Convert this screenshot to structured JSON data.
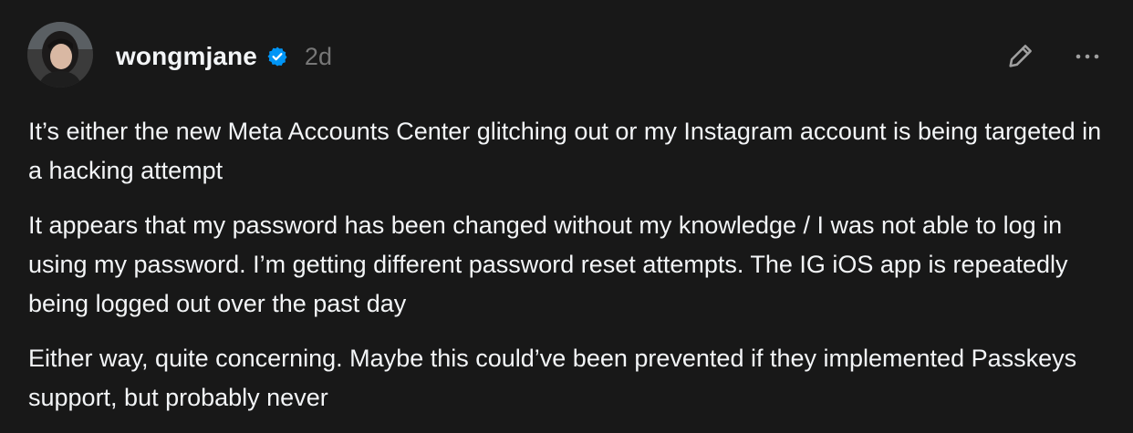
{
  "post": {
    "author": {
      "username": "wongmjane",
      "verified": true,
      "avatar_icon": "profile-photo"
    },
    "timestamp": "2d",
    "actions": {
      "edit_icon": "pencil-icon",
      "more_icon": "more-horizontal-icon"
    },
    "paragraphs": [
      "It’s either the new Meta Accounts Center glitching out or my Instagram account is being targeted in a hacking attempt",
      "It appears that my password has been changed without my knowledge / I was not able to log in using my password. I’m getting different password reset attempts. The IG iOS app is repeatedly being logged out over the past day",
      "Either way, quite concerning. Maybe this could’ve been prevented if they implemented Passkeys support, but probably never"
    ]
  },
  "colors": {
    "background": "#181818",
    "text_primary": "#f3f5f7",
    "text_secondary": "#777777",
    "verified_badge": "#0095f6"
  }
}
